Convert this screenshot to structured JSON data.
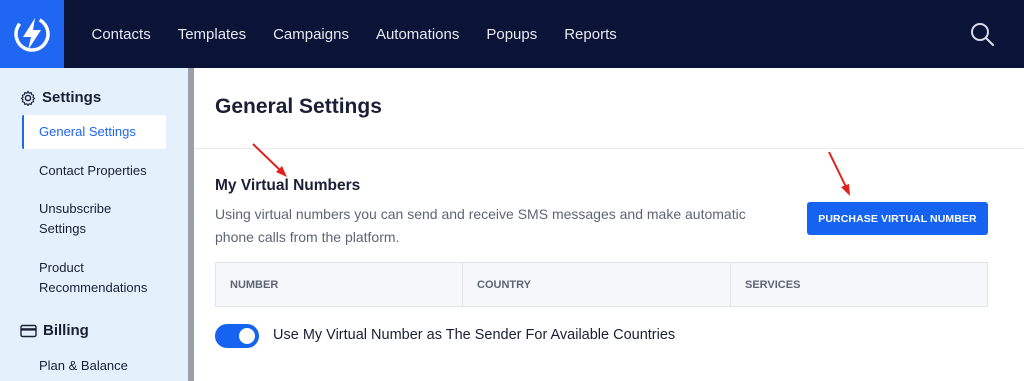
{
  "nav": {
    "items": [
      {
        "label": "Contacts"
      },
      {
        "label": "Templates"
      },
      {
        "label": "Campaigns"
      },
      {
        "label": "Automations"
      },
      {
        "label": "Popups"
      },
      {
        "label": "Reports"
      }
    ],
    "search_icon": "search-icon",
    "logo_icon": "lightning-bolt-icon"
  },
  "sidebar": {
    "settings_heading": "Settings",
    "settings_icon": "gear-icon",
    "items": [
      {
        "label": "General Settings",
        "active": true
      },
      {
        "label": "Contact Properties"
      },
      {
        "label": "Unsubscribe Settings"
      },
      {
        "label": "Product Recommendations"
      }
    ],
    "billing_heading": "Billing",
    "billing_icon": "credit-card-icon",
    "billing_items": [
      {
        "label": "Plan & Balance"
      }
    ]
  },
  "main": {
    "title": "General Settings",
    "section_title": "My Virtual Numbers",
    "section_description": "Using virtual numbers you can send and receive SMS messages and make automatic phone calls from the platform.",
    "purchase_button": "PURCHASE VIRTUAL NUMBER",
    "table_headers": [
      "NUMBER",
      "COUNTRY",
      "SERVICES"
    ],
    "toggle_label": "Use My Virtual Number as The Sender For Available Countries",
    "toggle_on": true
  },
  "colors": {
    "topbar": "#0b1437",
    "brand": "#1f66f2",
    "sidebar": "#e4f0fb",
    "annotation_arrow": "#e0201b"
  }
}
